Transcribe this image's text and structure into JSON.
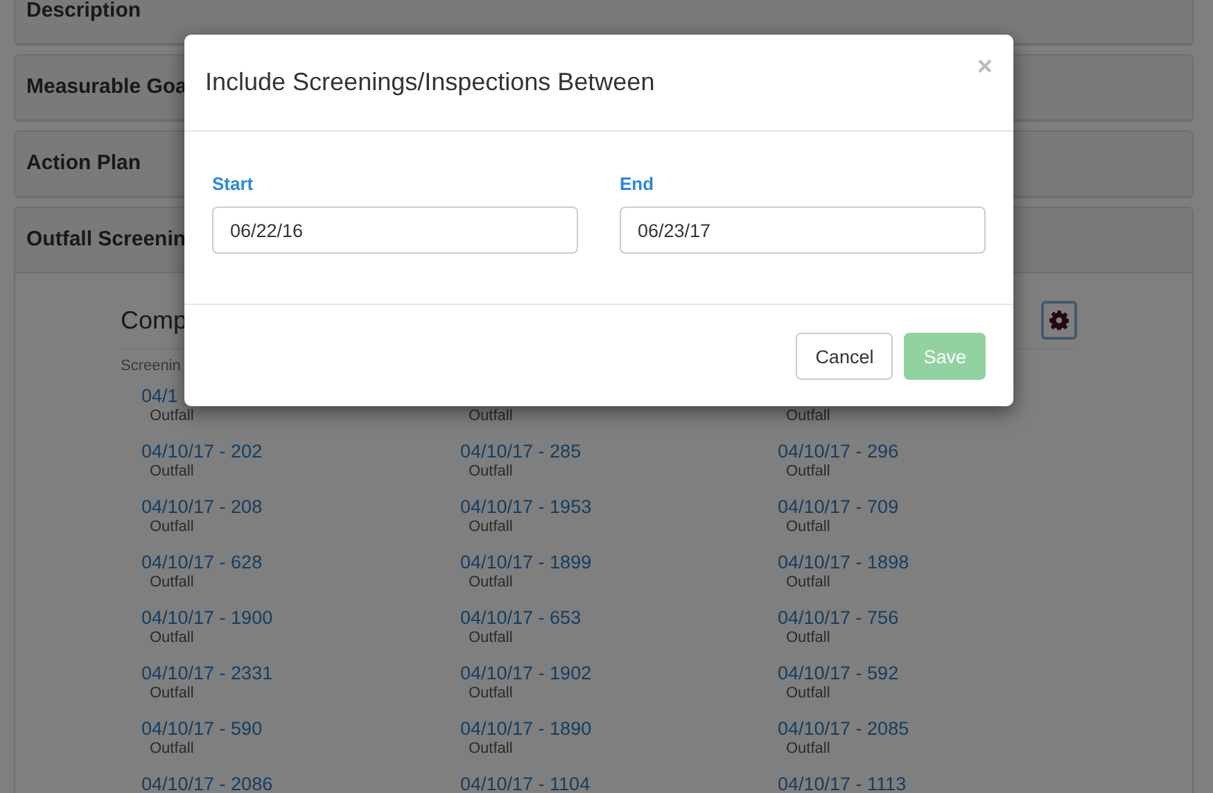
{
  "panels": [
    {
      "title": "Description"
    },
    {
      "title": "Measurable Goa"
    },
    {
      "title": "Action Plan"
    },
    {
      "title": "Outfall Screenin"
    }
  ],
  "section": {
    "heading": "Comp",
    "subheading": "Screenin"
  },
  "items": [
    {
      "link": "04/1",
      "type": "Outfall"
    },
    {
      "type": "Outfall"
    },
    {
      "type": "Outfall"
    },
    {
      "link": "04/10/17 - 202",
      "type": "Outfall"
    },
    {
      "link": "04/10/17 - 285",
      "type": "Outfall"
    },
    {
      "link": "04/10/17 - 296",
      "type": "Outfall"
    },
    {
      "link": "04/10/17 - 208",
      "type": "Outfall"
    },
    {
      "link": "04/10/17 - 1953",
      "type": "Outfall"
    },
    {
      "link": "04/10/17 - 709",
      "type": "Outfall"
    },
    {
      "link": "04/10/17 - 628",
      "type": "Outfall"
    },
    {
      "link": "04/10/17 - 1899",
      "type": "Outfall"
    },
    {
      "link": "04/10/17 - 1898",
      "type": "Outfall"
    },
    {
      "link": "04/10/17 - 1900",
      "type": "Outfall"
    },
    {
      "link": "04/10/17 - 653",
      "type": "Outfall"
    },
    {
      "link": "04/10/17 - 756",
      "type": "Outfall"
    },
    {
      "link": "04/10/17 - 2331",
      "type": "Outfall"
    },
    {
      "link": "04/10/17 - 1902",
      "type": "Outfall"
    },
    {
      "link": "04/10/17 - 592",
      "type": "Outfall"
    },
    {
      "link": "04/10/17 - 590",
      "type": "Outfall"
    },
    {
      "link": "04/10/17 - 1890",
      "type": "Outfall"
    },
    {
      "link": "04/10/17 - 2085",
      "type": "Outfall"
    },
    {
      "link": "04/10/17 - 2086"
    },
    {
      "link": "04/10/17 - 1104"
    },
    {
      "link": "04/10/17 - 1113"
    }
  ],
  "modal": {
    "title": "Include Screenings/Inspections Between",
    "close": "×",
    "fields": [
      {
        "label": "Start",
        "value": "06/22/16"
      },
      {
        "label": "End",
        "value": "06/23/17"
      }
    ],
    "buttons": [
      {
        "label": "Cancel",
        "kind": "default",
        "disabled": false
      },
      {
        "label": "Save",
        "kind": "success",
        "disabled": true
      }
    ]
  }
}
